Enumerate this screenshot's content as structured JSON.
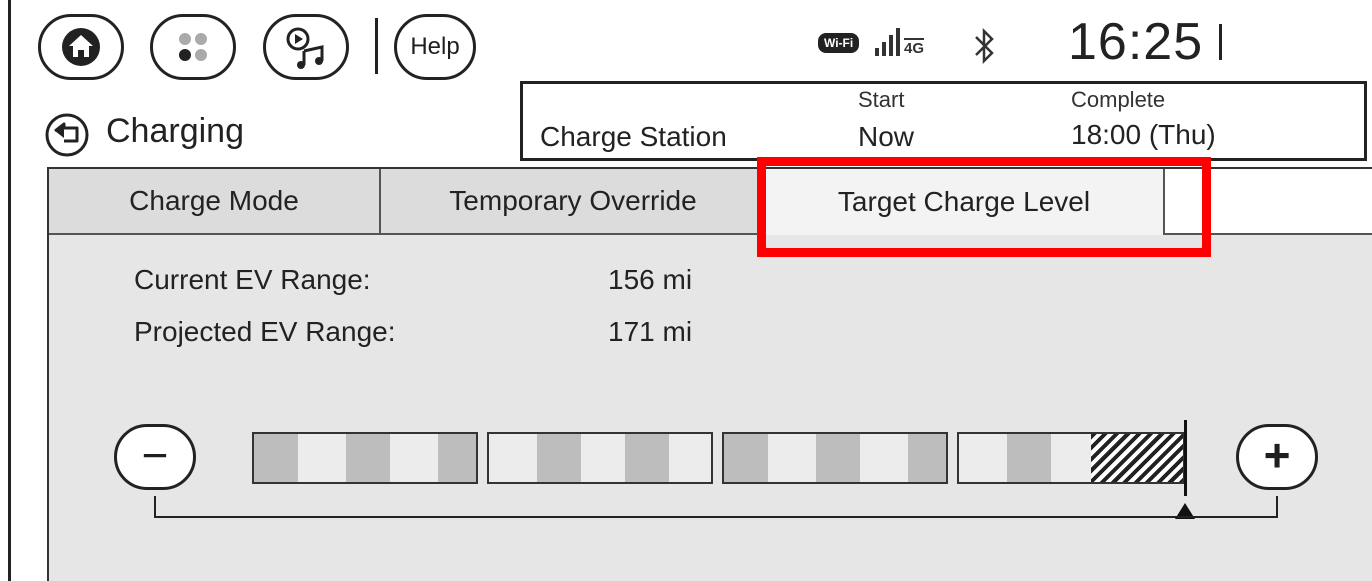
{
  "top_bar": {
    "help_label": "Help",
    "status_wifi_label": "Wi-Fi",
    "status_network_label": "4G",
    "time": "16:25"
  },
  "header": {
    "title": "Charging"
  },
  "charge_info": {
    "station_label": "Charge Station",
    "start_header": "Start",
    "start_value": "Now",
    "complete_header": "Complete",
    "complete_value": "18:00 (Thu)"
  },
  "tabs": [
    {
      "label": "Charge Mode"
    },
    {
      "label": "Temporary Override"
    },
    {
      "label": "Target Charge Level"
    }
  ],
  "selected_tab": "Target Charge Level",
  "ranges": {
    "current_label": "Current EV Range:",
    "current_value": "156 mi",
    "projected_label": "Projected EV Range:",
    "projected_value": "171 mi"
  },
  "target_level": {
    "minus_symbol": "−",
    "plus_symbol": "+",
    "level_fraction": 1.0
  },
  "colors": {
    "highlight": "#ff0000",
    "panel_bg": "#e6e6e6"
  }
}
